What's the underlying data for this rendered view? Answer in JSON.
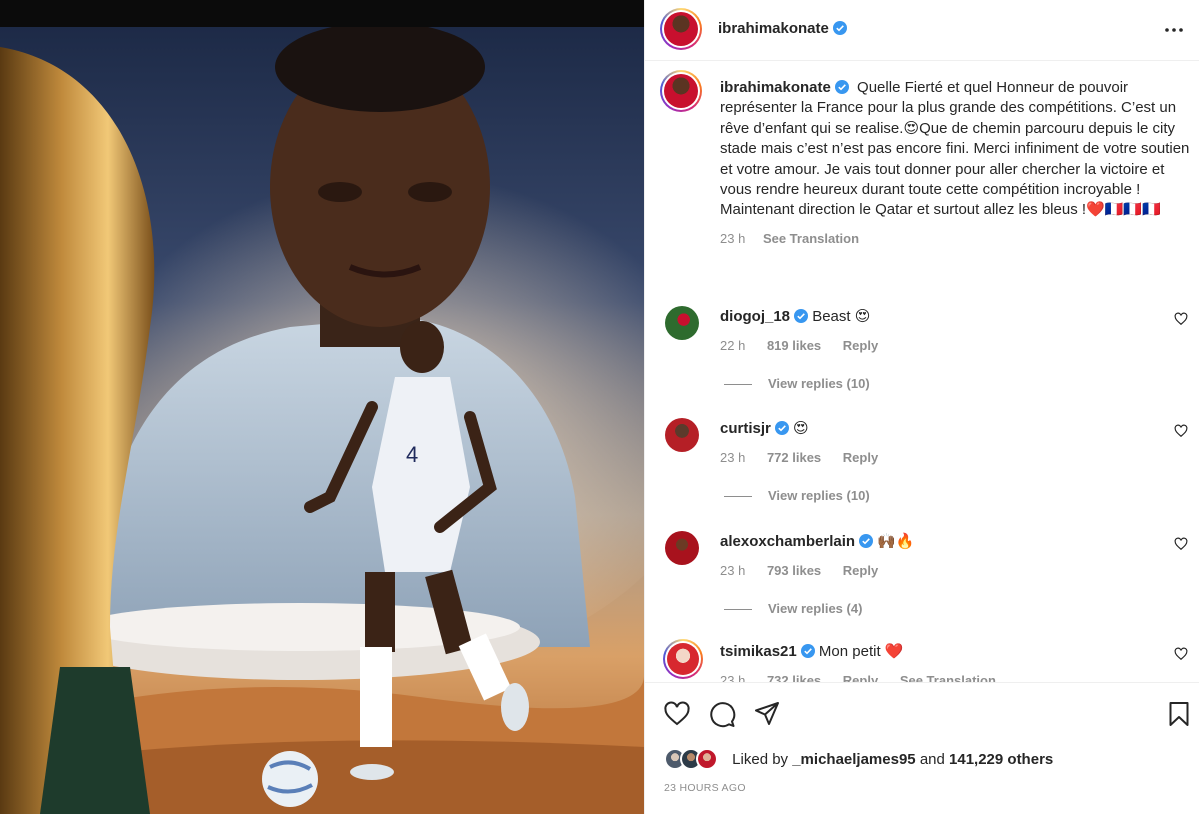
{
  "post": {
    "username": "ibrahimakonate",
    "verified": true,
    "image_jersey_number": "4"
  },
  "caption": {
    "username": "ibrahimakonate",
    "text": "Quelle Fierté et quel Honneur de pouvoir représenter la France pour la plus grande des compétitions. C’est un rêve d’enfant qui se realise.😍Que de chemin parcouru depuis le city stade mais c’est n’est pas encore fini. Merci infiniment de votre soutien et votre amour. Je vais tout donner pour aller chercher la victoire et vous rendre heureux durant toute cette compétition incroyable ! Maintenant direction le Qatar et surtout allez les bleus !❤️🇫🇷🇫🇷🇫🇷",
    "time": "23 h",
    "see_translation": "See Translation"
  },
  "comments": [
    {
      "username": "diogoj_18",
      "text": "Beast 😍",
      "time": "22 h",
      "likes": "819 likes",
      "reply": "Reply",
      "view_replies": "View replies (10)"
    },
    {
      "username": "curtisjr",
      "text": "😍",
      "time": "23 h",
      "likes": "772 likes",
      "reply": "Reply",
      "view_replies": "View replies (10)"
    },
    {
      "username": "alexoxchamberlain",
      "text": "🙌🏾🔥",
      "time": "23 h",
      "likes": "793 likes",
      "reply": "Reply",
      "view_replies": "View replies (4)"
    },
    {
      "username": "tsimikas21",
      "text": "Mon petit ❤️",
      "time": "23 h",
      "likes": "732 likes",
      "reply": "Reply",
      "see_translation": "See Translation"
    }
  ],
  "likes_bar": {
    "prefix": "Liked by",
    "first_liker": "_michaeljames95",
    "and": "and",
    "others": "141,229 others"
  },
  "time_ago": "23 HOURS AGO",
  "colors": {
    "verified_blue": "#3897f0",
    "secondary_text": "#8e8e8e",
    "primary_text": "#262626"
  }
}
